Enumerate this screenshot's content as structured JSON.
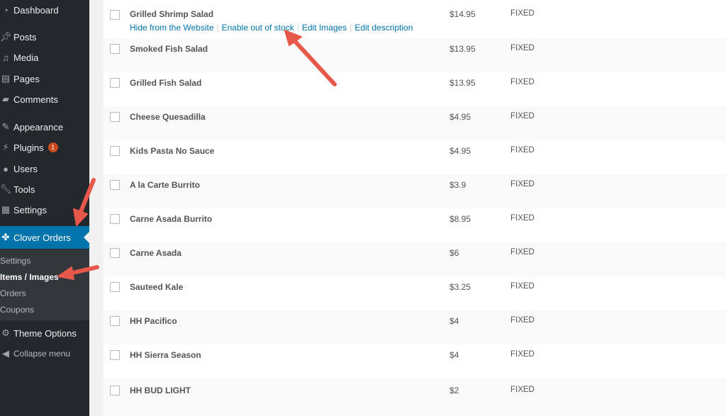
{
  "sidebar": {
    "items": [
      {
        "label": "Dashboard",
        "icon": "dashboard-icon"
      },
      {
        "label": "Posts",
        "icon": "pin-icon"
      },
      {
        "label": "Media",
        "icon": "media-icon"
      },
      {
        "label": "Pages",
        "icon": "page-icon"
      },
      {
        "label": "Comments",
        "icon": "comment-icon"
      },
      {
        "label": "Appearance",
        "icon": "paintbrush-icon"
      },
      {
        "label": "Plugins",
        "icon": "plugin-icon",
        "badge": "1"
      },
      {
        "label": "Users",
        "icon": "users-icon"
      },
      {
        "label": "Tools",
        "icon": "wrench-icon"
      },
      {
        "label": "Settings",
        "icon": "settings-icon"
      },
      {
        "label": "Clover Orders",
        "icon": "clover-icon"
      },
      {
        "label": "Theme Options",
        "icon": "gear-icon"
      },
      {
        "label": "Collapse menu",
        "icon": "collapse-icon"
      }
    ],
    "submenu": [
      "Settings",
      "Items / Images",
      "Orders",
      "Coupons"
    ]
  },
  "table": {
    "row_actions": [
      "Hide from the Website",
      "Enable out of stock",
      "Edit Images",
      "Edit description"
    ],
    "rows": [
      {
        "name": "Grilled Shrimp Salad",
        "price": "$14.95",
        "type": "FIXED"
      },
      {
        "name": "Smoked Fish Salad",
        "price": "$13.95",
        "type": "FIXED"
      },
      {
        "name": "Grilled Fish Salad",
        "price": "$13.95",
        "type": "FIXED"
      },
      {
        "name": "Cheese Quesadilla",
        "price": "$4.95",
        "type": "FIXED"
      },
      {
        "name": "Kids Pasta No Sauce",
        "price": "$4.95",
        "type": "FIXED"
      },
      {
        "name": "A la Carte Burrito",
        "price": "$3.9",
        "type": "FIXED"
      },
      {
        "name": "Carne Asada Burrito",
        "price": "$8.95",
        "type": "FIXED"
      },
      {
        "name": "Carne Asada",
        "price": "$6",
        "type": "FIXED"
      },
      {
        "name": "Sauteed Kale",
        "price": "$3.25",
        "type": "FIXED"
      },
      {
        "name": "HH Pacifico",
        "price": "$4",
        "type": "FIXED"
      },
      {
        "name": "HH Sierra Season",
        "price": "$4",
        "type": "FIXED"
      },
      {
        "name": "HH BUD LIGHT",
        "price": "$2",
        "type": "FIXED"
      }
    ]
  },
  "colors": {
    "sidebar_bg": "#23282d",
    "submenu_bg": "#32373c",
    "active_bg": "#0073aa",
    "link": "#0073aa",
    "badge": "#ca4a1f",
    "annotation_arrow": "#e8584a"
  }
}
